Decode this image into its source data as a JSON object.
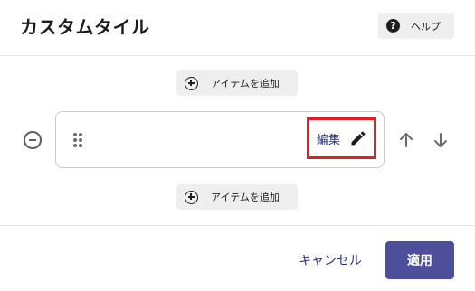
{
  "dialog": {
    "title": "カスタムタイル",
    "help_label": "ヘルプ",
    "help_icon_glyph": "?"
  },
  "editor": {
    "add_item_top_label": "アイテムを追加",
    "add_item_bottom_label": "アイテムを追加",
    "item": {
      "edit_label": "編集"
    }
  },
  "footer": {
    "cancel_label": "キャンセル",
    "apply_label": "適用"
  },
  "colors": {
    "primary": "#4d4f9b",
    "link": "#2c2f7c",
    "highlight": "#e01e24"
  },
  "icons": [
    "help-icon",
    "add-circle-icon",
    "remove-circle-icon",
    "drag-handle-icon",
    "pencil-icon",
    "arrow-up-icon",
    "arrow-down-icon"
  ]
}
